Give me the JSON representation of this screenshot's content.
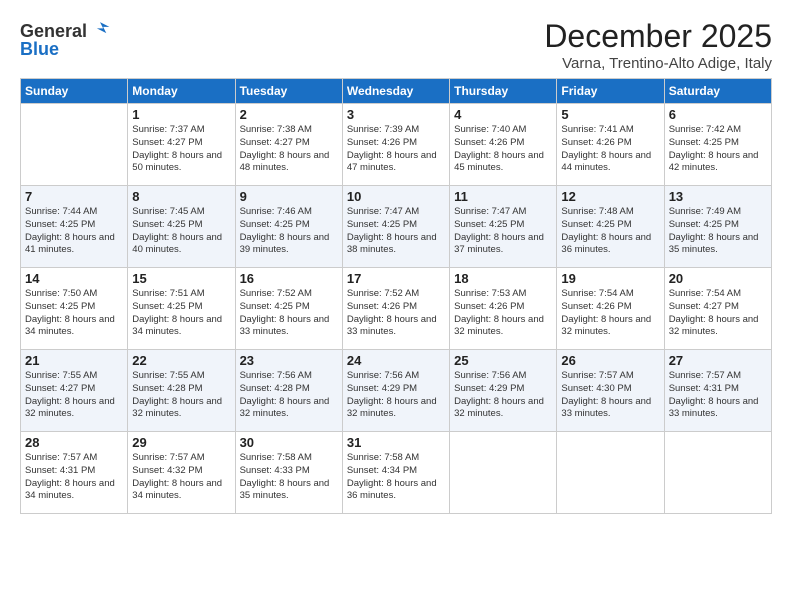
{
  "logo": {
    "general": "General",
    "blue": "Blue"
  },
  "title": "December 2025",
  "location": "Varna, Trentino-Alto Adige, Italy",
  "days_of_week": [
    "Sunday",
    "Monday",
    "Tuesday",
    "Wednesday",
    "Thursday",
    "Friday",
    "Saturday"
  ],
  "weeks": [
    [
      {
        "day": "",
        "sunrise": "",
        "sunset": "",
        "daylight": ""
      },
      {
        "day": "1",
        "sunrise": "7:37 AM",
        "sunset": "4:27 PM",
        "daylight": "8 hours and 50 minutes."
      },
      {
        "day": "2",
        "sunrise": "7:38 AM",
        "sunset": "4:27 PM",
        "daylight": "8 hours and 48 minutes."
      },
      {
        "day": "3",
        "sunrise": "7:39 AM",
        "sunset": "4:26 PM",
        "daylight": "8 hours and 47 minutes."
      },
      {
        "day": "4",
        "sunrise": "7:40 AM",
        "sunset": "4:26 PM",
        "daylight": "8 hours and 45 minutes."
      },
      {
        "day": "5",
        "sunrise": "7:41 AM",
        "sunset": "4:26 PM",
        "daylight": "8 hours and 44 minutes."
      },
      {
        "day": "6",
        "sunrise": "7:42 AM",
        "sunset": "4:25 PM",
        "daylight": "8 hours and 42 minutes."
      }
    ],
    [
      {
        "day": "7",
        "sunrise": "7:44 AM",
        "sunset": "4:25 PM",
        "daylight": "8 hours and 41 minutes."
      },
      {
        "day": "8",
        "sunrise": "7:45 AM",
        "sunset": "4:25 PM",
        "daylight": "8 hours and 40 minutes."
      },
      {
        "day": "9",
        "sunrise": "7:46 AM",
        "sunset": "4:25 PM",
        "daylight": "8 hours and 39 minutes."
      },
      {
        "day": "10",
        "sunrise": "7:47 AM",
        "sunset": "4:25 PM",
        "daylight": "8 hours and 38 minutes."
      },
      {
        "day": "11",
        "sunrise": "7:47 AM",
        "sunset": "4:25 PM",
        "daylight": "8 hours and 37 minutes."
      },
      {
        "day": "12",
        "sunrise": "7:48 AM",
        "sunset": "4:25 PM",
        "daylight": "8 hours and 36 minutes."
      },
      {
        "day": "13",
        "sunrise": "7:49 AM",
        "sunset": "4:25 PM",
        "daylight": "8 hours and 35 minutes."
      }
    ],
    [
      {
        "day": "14",
        "sunrise": "7:50 AM",
        "sunset": "4:25 PM",
        "daylight": "8 hours and 34 minutes."
      },
      {
        "day": "15",
        "sunrise": "7:51 AM",
        "sunset": "4:25 PM",
        "daylight": "8 hours and 34 minutes."
      },
      {
        "day": "16",
        "sunrise": "7:52 AM",
        "sunset": "4:25 PM",
        "daylight": "8 hours and 33 minutes."
      },
      {
        "day": "17",
        "sunrise": "7:52 AM",
        "sunset": "4:26 PM",
        "daylight": "8 hours and 33 minutes."
      },
      {
        "day": "18",
        "sunrise": "7:53 AM",
        "sunset": "4:26 PM",
        "daylight": "8 hours and 32 minutes."
      },
      {
        "day": "19",
        "sunrise": "7:54 AM",
        "sunset": "4:26 PM",
        "daylight": "8 hours and 32 minutes."
      },
      {
        "day": "20",
        "sunrise": "7:54 AM",
        "sunset": "4:27 PM",
        "daylight": "8 hours and 32 minutes."
      }
    ],
    [
      {
        "day": "21",
        "sunrise": "7:55 AM",
        "sunset": "4:27 PM",
        "daylight": "8 hours and 32 minutes."
      },
      {
        "day": "22",
        "sunrise": "7:55 AM",
        "sunset": "4:28 PM",
        "daylight": "8 hours and 32 minutes."
      },
      {
        "day": "23",
        "sunrise": "7:56 AM",
        "sunset": "4:28 PM",
        "daylight": "8 hours and 32 minutes."
      },
      {
        "day": "24",
        "sunrise": "7:56 AM",
        "sunset": "4:29 PM",
        "daylight": "8 hours and 32 minutes."
      },
      {
        "day": "25",
        "sunrise": "7:56 AM",
        "sunset": "4:29 PM",
        "daylight": "8 hours and 32 minutes."
      },
      {
        "day": "26",
        "sunrise": "7:57 AM",
        "sunset": "4:30 PM",
        "daylight": "8 hours and 33 minutes."
      },
      {
        "day": "27",
        "sunrise": "7:57 AM",
        "sunset": "4:31 PM",
        "daylight": "8 hours and 33 minutes."
      }
    ],
    [
      {
        "day": "28",
        "sunrise": "7:57 AM",
        "sunset": "4:31 PM",
        "daylight": "8 hours and 34 minutes."
      },
      {
        "day": "29",
        "sunrise": "7:57 AM",
        "sunset": "4:32 PM",
        "daylight": "8 hours and 34 minutes."
      },
      {
        "day": "30",
        "sunrise": "7:58 AM",
        "sunset": "4:33 PM",
        "daylight": "8 hours and 35 minutes."
      },
      {
        "day": "31",
        "sunrise": "7:58 AM",
        "sunset": "4:34 PM",
        "daylight": "8 hours and 36 minutes."
      },
      {
        "day": "",
        "sunrise": "",
        "sunset": "",
        "daylight": ""
      },
      {
        "day": "",
        "sunrise": "",
        "sunset": "",
        "daylight": ""
      },
      {
        "day": "",
        "sunrise": "",
        "sunset": "",
        "daylight": ""
      }
    ]
  ]
}
